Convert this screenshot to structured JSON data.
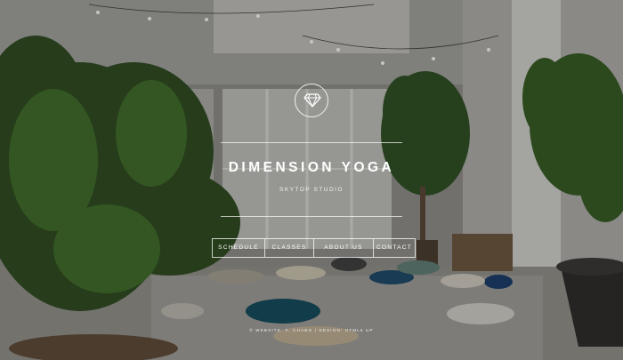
{
  "site": {
    "title": "DIMENSION YOGA",
    "subtitle": "SKYTOP STUDIO",
    "logo_icon": "diamond-icon"
  },
  "nav": {
    "items": [
      {
        "label": "SCHEDULE"
      },
      {
        "label": "CLASSES"
      },
      {
        "label": "ABOUT US"
      },
      {
        "label": "CONTACT"
      }
    ]
  },
  "footer": {
    "text": "© WEBSITE. F. CHABO | DESIGN: HTML5 UP"
  },
  "colors": {
    "text": "#ffffff",
    "overlay": "rgba(0,0,0,0.18)"
  }
}
